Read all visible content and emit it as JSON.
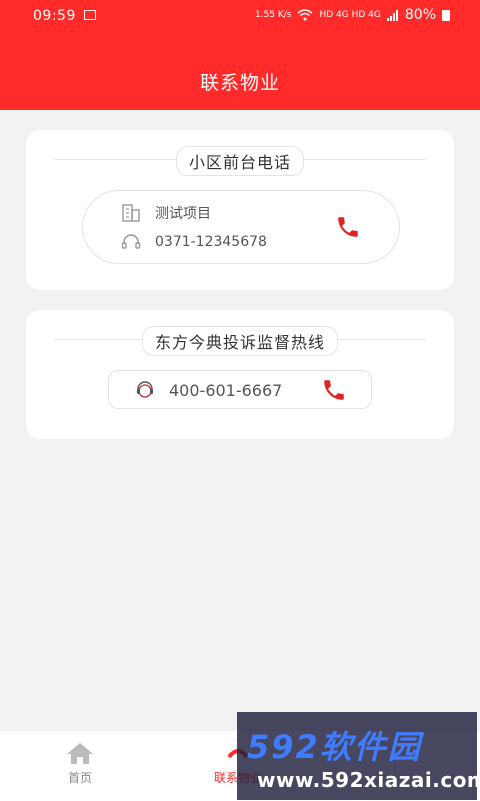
{
  "status_bar": {
    "time": "09:59",
    "speed": "1.55 K/s",
    "network": "HD 4G HD 4G",
    "battery": "80%"
  },
  "header": {
    "title": "联系物业"
  },
  "front_desk": {
    "section_title": "小区前台电话",
    "project_name": "测试项目",
    "phone": "0371-12345678"
  },
  "complaint": {
    "section_title": "东方今典投诉监督热线",
    "phone": "400-601-6667"
  },
  "tabbar": {
    "tabs": [
      {
        "label": "首页"
      },
      {
        "label": "联系物业"
      }
    ]
  },
  "watermark": {
    "brand": "592软件园",
    "url": "www.592xiazai.com"
  },
  "colors": {
    "accent": "#ff2b2b",
    "phone_icon": "#e02424"
  }
}
